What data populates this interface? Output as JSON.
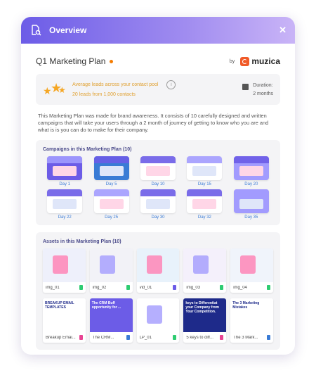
{
  "header": {
    "title": "Overview",
    "close": "✕"
  },
  "plan": {
    "title": "Q1 Marketing Plan",
    "by": "by",
    "brand": "muzica",
    "stat_title": "Average leads across your contact pool",
    "stat_value": "20 leads from 1,000 contacts",
    "info": "i",
    "duration_label": "Duration:",
    "duration_value": "2 months",
    "description": "This Marketing Plan was made for brand awareness. It consists of 10 carefully designed and written campaigns that will take your users through a 2 month of journey of getting to know who you are and what is is you can do to make for their company."
  },
  "campaigns": {
    "title": "Campaigns in this Marketing Plan (10)",
    "items": [
      {
        "label": "Day 1",
        "bg": "#6c5ce7"
      },
      {
        "label": "Day 5",
        "bg": "#3a7bd5"
      },
      {
        "label": "Day 10",
        "bg": "#ffffff"
      },
      {
        "label": "Day 15",
        "bg": "#ffffff"
      },
      {
        "label": "Day 20",
        "bg": "#a29bfe"
      },
      {
        "label": "Day 22",
        "bg": "#ffffff"
      },
      {
        "label": "Day 25",
        "bg": "#ffffff"
      },
      {
        "label": "Day 30",
        "bg": "#ffffff"
      },
      {
        "label": "Day 32",
        "bg": "#ffffff"
      },
      {
        "label": "Day 35",
        "bg": "#a29bfe"
      }
    ]
  },
  "assets": {
    "title": "Assets in this Marketing Plan (10)",
    "items": [
      {
        "name": "img_01",
        "badge": "#2ecc71"
      },
      {
        "name": "img_02",
        "badge": "#2ecc71"
      },
      {
        "name": "vid_01",
        "badge": "#6c5ce7"
      },
      {
        "name": "img_03",
        "badge": "#2ecc71"
      },
      {
        "name": "img_04",
        "badge": "#2ecc71"
      },
      {
        "name": "Breakup Emai...",
        "badge": "#e84393",
        "thumb_text": "BREAKUP EMAIL TEMPLATES"
      },
      {
        "name": "The CRM...",
        "badge": "#3a7bd5",
        "thumb_text": "The CRM Buff opportunity for ..."
      },
      {
        "name": "LP_01",
        "badge": "#2ecc71"
      },
      {
        "name": "5 keys to diff...",
        "badge": "#e84393",
        "thumb_text": "keys to Differentiat your Company from Your Competition."
      },
      {
        "name": "The 3 Mark...",
        "badge": "#3a7bd5",
        "thumb_text": "The 3 Marketing Mistakes"
      }
    ]
  }
}
